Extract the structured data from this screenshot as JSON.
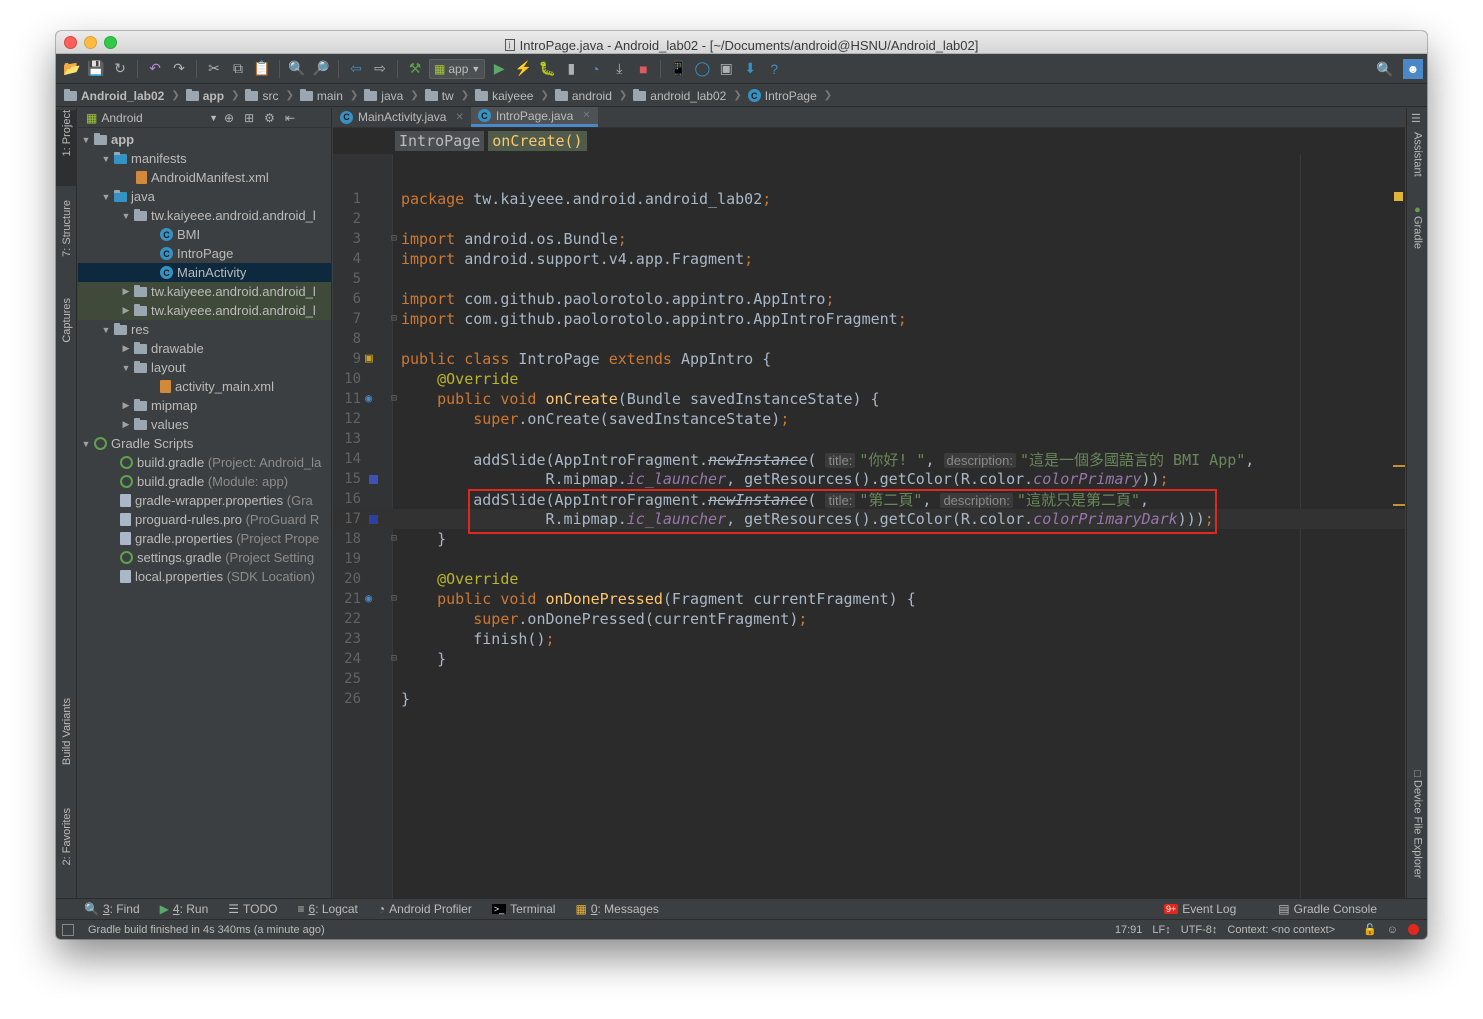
{
  "window": {
    "title": "IntroPage.java - Android_lab02 - [~/Documents/android@HSNU/Android_lab02]"
  },
  "toolbar": {
    "run_config": "app"
  },
  "breadcrumb": [
    "Android_lab02",
    "app",
    "src",
    "main",
    "java",
    "tw",
    "kaiyeee",
    "android",
    "android_lab02",
    "IntroPage"
  ],
  "left_tabs": [
    "1: Project",
    "7: Structure",
    "Captures",
    "Build Variants",
    "2: Favorites"
  ],
  "right_tabs": [
    "Assistant",
    "Gradle",
    "Device File Explorer"
  ],
  "project_panel": {
    "view_mode": "Android",
    "tree": [
      "app",
      "manifests",
      "AndroidManifest.xml",
      "java",
      "tw.kaiyeee.android.android_l",
      "BMI",
      "IntroPage",
      "MainActivity",
      "tw.kaiyeee.android.android_l",
      "tw.kaiyeee.android.android_l",
      "res",
      "drawable",
      "layout",
      "activity_main.xml",
      "mipmap",
      "values",
      "Gradle Scripts",
      "build.gradle",
      "(Project: Android_la",
      "build.gradle",
      "(Module: app)",
      "gradle-wrapper.properties",
      "(Gra",
      "proguard-rules.pro",
      "(ProGuard R",
      "gradle.properties",
      "(Project Prope",
      "settings.gradle",
      "(Project Setting",
      "local.properties",
      "(SDK Location)"
    ]
  },
  "editor": {
    "tabs": [
      "MainActivity.java",
      "IntroPage.java"
    ],
    "crumbs": [
      "IntroPage",
      "onCreate()"
    ],
    "line_numbers": [
      "1",
      "2",
      "3",
      "4",
      "5",
      "6",
      "7",
      "8",
      "9",
      "10",
      "11",
      "12",
      "13",
      "14",
      "15",
      "16",
      "17",
      "18",
      "19",
      "20",
      "21",
      "22",
      "23",
      "24",
      "25",
      "26"
    ],
    "code": {
      "l1": [
        "package",
        " tw.kaiyeee.android.android_lab02",
        ";"
      ],
      "l3": [
        "import",
        " android.os.Bundle",
        ";"
      ],
      "l4": [
        "import",
        " android.support.v4.app.Fragment",
        ";"
      ],
      "l6": [
        "import",
        " com.github.paolorotolo.appintro.AppIntro",
        ";"
      ],
      "l7": [
        "import",
        " com.github.paolorotolo.appintro.AppIntroFragment",
        ";"
      ],
      "l9": [
        "public class",
        " IntroPage ",
        "extends",
        " AppIntro {"
      ],
      "l10": [
        "@Override"
      ],
      "l11": [
        "public void",
        " ",
        "onCreate",
        "(Bundle savedInstanceState) {"
      ],
      "l12": [
        "super",
        ".onCreate(savedInstanceState)",
        ";"
      ],
      "l14": [
        "addSlide(AppIntroFragment.",
        "newInstance",
        "(",
        "title:",
        "\"你好! \"",
        ", ",
        "description:",
        "\"這是一個多國語言的 BMI App\"",
        ","
      ],
      "l15": [
        "R.mipmap.",
        "ic_launcher",
        ", getResources().getColor(R.color.",
        "colorPrimary",
        "))",
        ";"
      ],
      "l16": [
        "addSlide(AppIntroFragment.",
        "newInstance",
        "(",
        "title:",
        "\"第二頁\"",
        ", ",
        "description:",
        "\"這就只是第二頁\"",
        ","
      ],
      "l17": [
        "R.mipmap.",
        "ic_launcher",
        ", getResources().getColor(R.color.",
        "colorPrimaryDark",
        ")))",
        ";"
      ],
      "l18": [
        "}"
      ],
      "l20": [
        "@Override"
      ],
      "l21": [
        "public void",
        " ",
        "onDonePressed",
        "(Fragment currentFragment) {"
      ],
      "l22": [
        "super",
        ".onDonePressed(currentFragment)",
        ";"
      ],
      "l23": [
        "finish()",
        ";"
      ],
      "l24": [
        "}"
      ],
      "l26": [
        "}"
      ]
    }
  },
  "bottom_tabs": {
    "find": {
      "key": "3",
      "label": ": Find"
    },
    "run": {
      "key": "4",
      "label": ": Run"
    },
    "todo": "TODO",
    "logcat": {
      "key": "6",
      "label": ": Logcat"
    },
    "profiler": "Android Profiler",
    "terminal": "Terminal",
    "messages": {
      "key": "0",
      "label": ": Messages"
    },
    "event_log": "Event Log",
    "event_log_badge": "9+",
    "gradle_console": "Gradle Console"
  },
  "status": {
    "message": "Gradle build finished in 4s 340ms (a minute ago)",
    "position": "17:91",
    "line_sep": "LF↕",
    "encoding": "UTF-8↕",
    "context": "Context: <no context>"
  },
  "colors": {
    "accent": "#4a88c7",
    "highlight_box": "#e0281e",
    "keyword": "#cc7832",
    "function": "#ffc66d"
  }
}
